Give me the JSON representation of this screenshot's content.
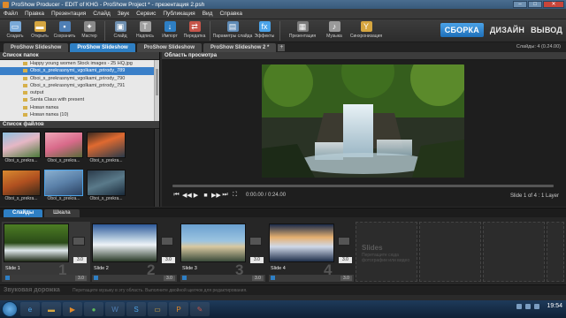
{
  "window": {
    "title": "ProShow Producer - EDIT of KHG - ProShow Project * - презентация 2.psh",
    "buttons": [
      "–",
      "□",
      "✕"
    ]
  },
  "menu": [
    "Файл",
    "Правка",
    "Презентация",
    "Слайд",
    "Звук",
    "Сервис",
    "Публикация",
    "Вид",
    "Справка"
  ],
  "toolbar": {
    "group1": [
      {
        "label": "Создать",
        "icon": "new-icon",
        "color": "#7aa9d8",
        "glyph": "▭"
      },
      {
        "label": "Открыть",
        "icon": "open-folder-icon",
        "color": "#d6a640",
        "glyph": "▬"
      },
      {
        "label": "Сохранить",
        "icon": "save-icon",
        "color": "#4f7fb5",
        "glyph": "▪"
      },
      {
        "label": "Мастер",
        "icon": "wizard-icon",
        "color": "#8a8a8a",
        "glyph": "✦"
      }
    ],
    "group2": [
      {
        "label": "Слайд",
        "icon": "slide-icon",
        "color": "#6e8fb0",
        "glyph": "▣"
      },
      {
        "label": "Надпись",
        "icon": "caption-icon",
        "color": "#a0a0a0",
        "glyph": "T"
      },
      {
        "label": "Импорт",
        "icon": "import-icon",
        "color": "#2e7fc4",
        "glyph": "↓"
      },
      {
        "label": "Передатка",
        "icon": "transition-icon",
        "color": "#c6554a",
        "glyph": "⇄"
      }
    ],
    "group3": [
      {
        "label": "Параметры слайда",
        "icon": "slide-settings-icon",
        "color": "#5f8bb6",
        "glyph": "▤",
        "wide": true
      },
      {
        "label": "Эффекты",
        "icon": "effects-icon",
        "color": "#4ba3e8",
        "glyph": "fx"
      }
    ],
    "group4": [
      {
        "label": "Презентация",
        "icon": "presentation-icon",
        "color": "#7a7a7a",
        "glyph": "▦",
        "wide": true
      },
      {
        "label": "Музыка",
        "icon": "music-icon",
        "color": "#9a9a9a",
        "glyph": "♪"
      },
      {
        "label": "Синхронизация",
        "icon": "sync-icon",
        "color": "#d6a640",
        "glyph": "Y",
        "wide": true
      }
    ]
  },
  "modes": [
    "СБОРКА",
    "ДИЗАЙН",
    "ВЫВОД"
  ],
  "project_tabs": [
    "ProShow Slideshow",
    "ProShow Slideshow",
    "ProShow Slideshow",
    "ProShow Slideshow 2 *"
  ],
  "slide_count": "Слайды: 4 (0.24.00)",
  "folder_panel": {
    "title": "Список папок",
    "items": [
      "Happy young women Stock images - 25 HQ.jpg",
      "Oboi_s_prekrasnymi_vgolkami_prirody_789",
      "Oboi_s_prekrasnymi_vgolkami_prirody_790",
      "Oboi_s_prekrasnymi_vgolkami_prirody_791",
      "output",
      "Santa Claus with present",
      "Новая папка",
      "Новая папка (10)"
    ],
    "selected_index": 1
  },
  "file_panel": {
    "title": "Список файлов",
    "files": [
      "Oboi_s_prekra...",
      "Oboi_s_prekra...",
      "Oboi_s_prekra...",
      "Oboi_s_prekra...",
      "Oboi_s_prekra...",
      "Oboi_s_prekra..."
    ],
    "selected_index": 4
  },
  "preview": {
    "title": "Область просмотра",
    "time": "0:00.00 / 0:24.00",
    "slide_info": "Slide 1 of 4 : 1 Layer",
    "progress": 0.0
  },
  "timeline_tabs": [
    "Слайды",
    "Шкала"
  ],
  "slides": [
    {
      "name": "Slide 1",
      "number": "1",
      "duration": "3.0",
      "theme": "forest"
    },
    {
      "name": "Slide 2",
      "number": "2",
      "duration": "3.0",
      "theme": "mountain"
    },
    {
      "name": "Slide 3",
      "number": "3",
      "duration": "3.0",
      "theme": "coast"
    },
    {
      "name": "Slide 4",
      "number": "4",
      "duration": "3.0",
      "theme": "winter"
    }
  ],
  "placeholder": {
    "title": "Slides",
    "text": "Перетащите сюда фотографии или видео"
  },
  "audio": {
    "label": "Звуковая дорожка",
    "hint": "Перетащите музыку в эту область. Выполните двойной щелчок для редактирования."
  },
  "taskbar": {
    "clock": "19:54"
  }
}
